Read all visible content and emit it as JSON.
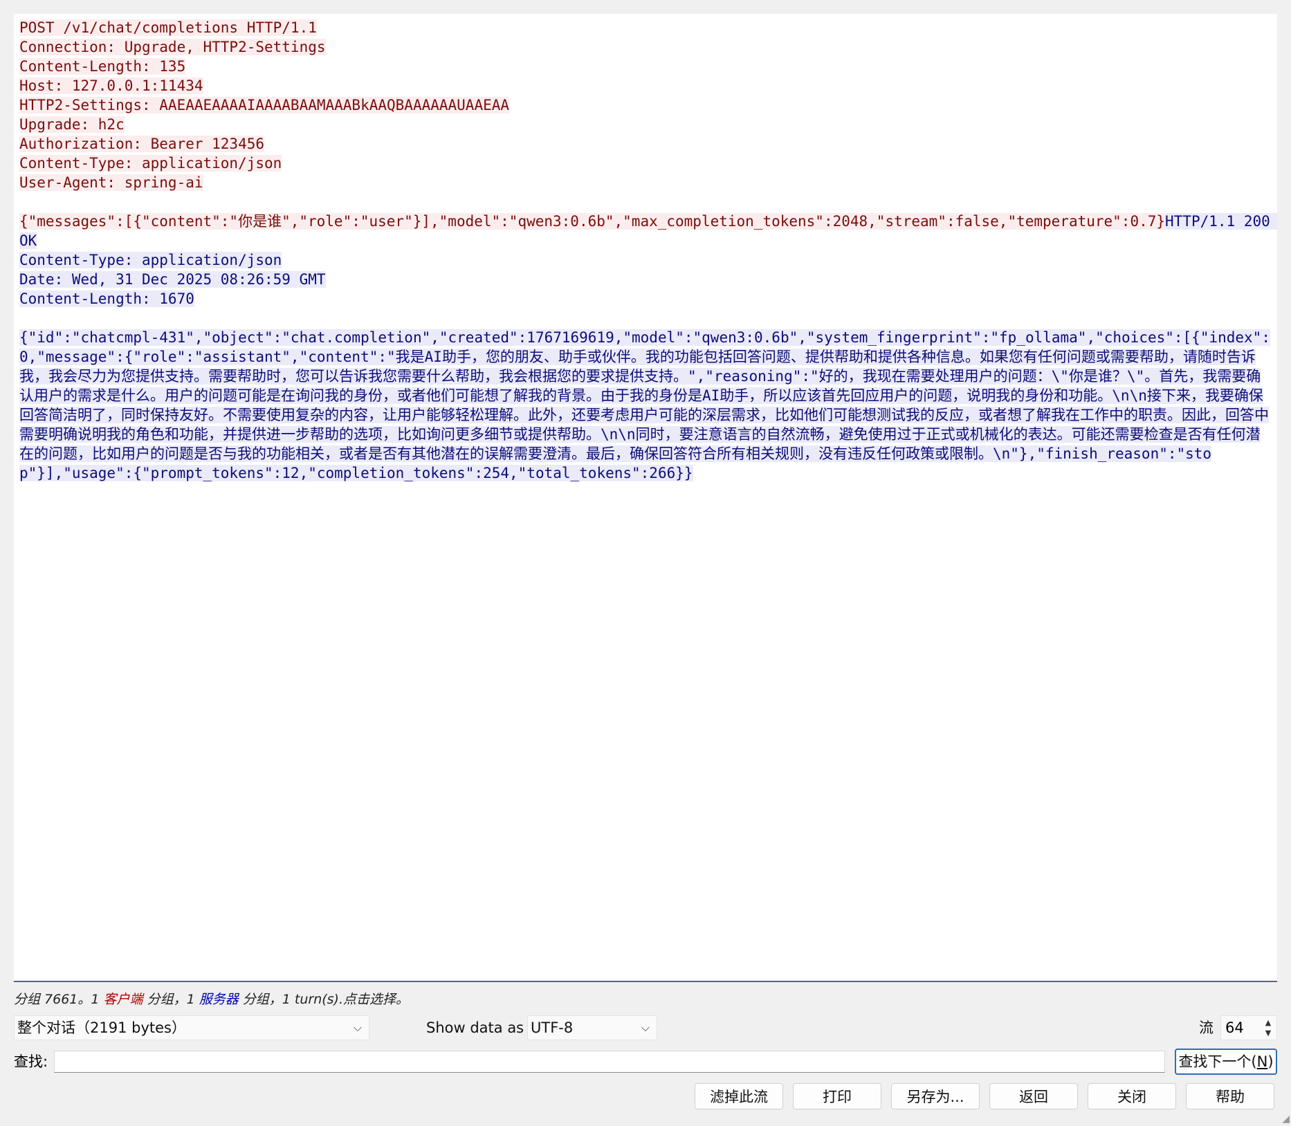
{
  "stream": {
    "request_headers": [
      "POST /v1/chat/completions HTTP/1.1",
      "Connection: Upgrade, HTTP2-Settings",
      "Content-Length: 135",
      "Host: 127.0.0.1:11434",
      "HTTP2-Settings: AAEAAEAAAAIAAAABAAMAAABkAAQBAAAAAAUAAEAA",
      "Upgrade: h2c",
      "Authorization: Bearer 123456",
      "Content-Type: application/json",
      "User-Agent: spring-ai"
    ],
    "request_body": "{\"messages\":[{\"content\":\"你是谁\",\"role\":\"user\"}],\"model\":\"qwen3:0.6b\",\"max_completion_tokens\":2048,\"stream\":false,\"temperature\":0.7}",
    "response_status": "HTTP/1.1 200 OK",
    "response_headers": [
      "Content-Type: application/json",
      "Date: Wed, 31 Dec 2025 08:26:59 GMT",
      "Content-Length: 1670"
    ],
    "response_body": "{\"id\":\"chatcmpl-431\",\"object\":\"chat.completion\",\"created\":1767169619,\"model\":\"qwen3:0.6b\",\"system_fingerprint\":\"fp_ollama\",\"choices\":[{\"index\":0,\"message\":{\"role\":\"assistant\",\"content\":\"我是AI助手，您的朋友、助手或伙伴。我的功能包括回答问题、提供帮助和提供各种信息。如果您有任何问题或需要帮助，请随时告诉我，我会尽力为您提供支持。需要帮助时，您可以告诉我您需要什么帮助，我会根据您的要求提供支持。\",\"reasoning\":\"好的，我现在需要处理用户的问题：\\\"你是谁？\\\"。首先，我需要确认用户的需求是什么。用户的问题可能是在询问我的身份，或者他们可能想了解我的背景。由于我的身份是AI助手，所以应该首先回应用户的问题，说明我的身份和功能。\\n\\n接下来，我要确保回答简洁明了，同时保持友好。不需要使用复杂的内容，让用户能够轻松理解。此外，还要考虑用户可能的深层需求，比如他们可能想测试我的反应，或者想了解我在工作中的职责。因此，回答中需要明确说明我的角色和功能，并提供进一步帮助的选项，比如询问更多细节或提供帮助。\\n\\n同时，要注意语言的自然流畅，避免使用过于正式或机械化的表达。可能还需要检查是否有任何潜在的问题，比如用户的问题是否与我的功能相关，或者是否有其他潜在的误解需要澄清。最后，确保回答符合所有相关规则，没有违反任何政策或限制。\\n\"},\"finish_reason\":\"stop\"}],\"usage\":{\"prompt_tokens\":12,\"completion_tokens\":254,\"total_tokens\":266}}"
  },
  "status": {
    "prefix": "分组 7661。1 ",
    "client_word": "客户端",
    "mid": " 分组，1 ",
    "server_word": "服务器",
    "suffix": " 分组，1 turn(s).点击选择。"
  },
  "controls": {
    "conversation_select": "整个对话（2191 bytes）",
    "show_data_label": "Show data as",
    "encoding_select": "UTF-8",
    "stream_label": "流",
    "stream_number": "64"
  },
  "find": {
    "label": "查找:",
    "value": "",
    "next_button": "查找下一个(",
    "next_mnemonic": "N",
    "next_close": ")"
  },
  "buttons": {
    "filter_out": "滤掉此流",
    "print": "打印",
    "save_as": "另存为...",
    "back": "返回",
    "close": "关闭",
    "help": "帮助"
  },
  "colors": {
    "client_text": "#7a0d0d",
    "client_bg": "#fbeded",
    "server_text": "#0d0d7a",
    "server_bg": "#eaeaf8",
    "accent": "#2f6fb3"
  }
}
